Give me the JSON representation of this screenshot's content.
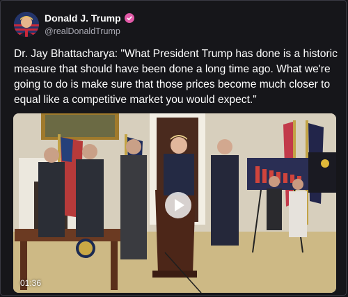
{
  "post": {
    "author_name": "Donald J. Trump",
    "handle": "@realDonaldTrump",
    "text": "Dr. Jay Bhattacharya: \"What President Trump has done is a historic measure that should have been done a long time ago. What we're going to do is make sure that those prices become much closer to equal like a competitive market you would expect.\"",
    "verified_badge_color": "#e25aa8"
  },
  "video": {
    "duration": "01:36",
    "play_icon": "play-icon"
  }
}
